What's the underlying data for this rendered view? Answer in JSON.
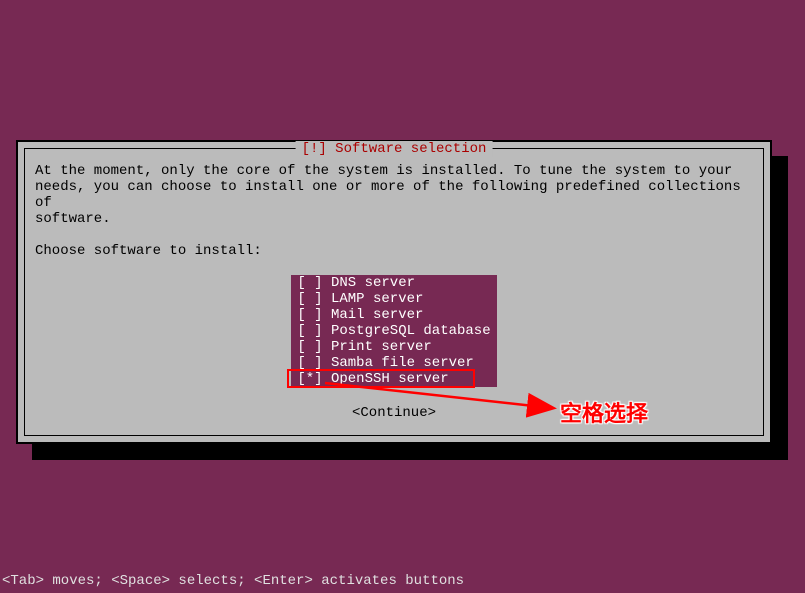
{
  "dialog": {
    "title": "[!] Software selection",
    "description": "At the moment, only the core of the system is installed. To tune the system to your\nneeds, you can choose to install one or more of the following predefined collections of\nsoftware.",
    "prompt": "Choose software to install:",
    "options": [
      {
        "label": "DNS server",
        "selected": false
      },
      {
        "label": "LAMP server",
        "selected": false
      },
      {
        "label": "Mail server",
        "selected": false
      },
      {
        "label": "PostgreSQL database",
        "selected": false
      },
      {
        "label": "Print server",
        "selected": false
      },
      {
        "label": "Samba file server",
        "selected": false
      },
      {
        "label": "OpenSSH server",
        "selected": true
      }
    ],
    "continue_label": "<Continue>"
  },
  "annotation": {
    "text": "空格选择"
  },
  "help": {
    "text": "<Tab> moves; <Space> selects; <Enter> activates buttons"
  }
}
